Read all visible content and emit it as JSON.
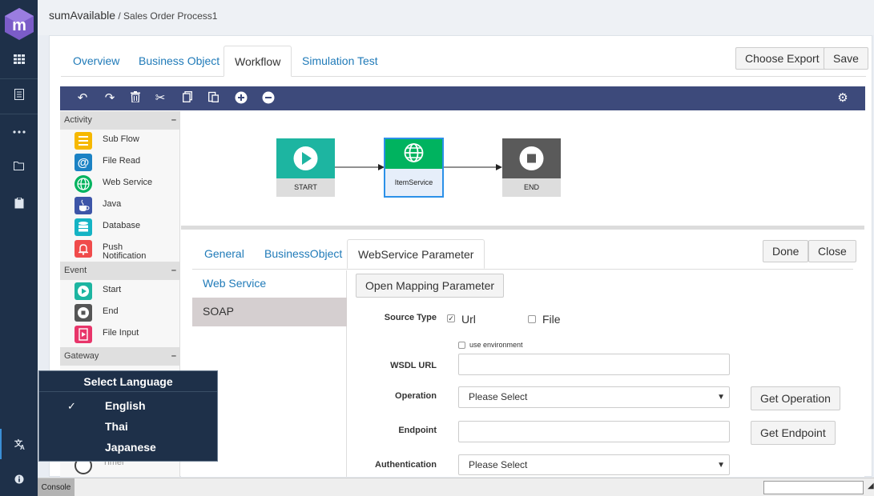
{
  "header": {
    "app_name": "sumAvailable",
    "separator": " / ",
    "process_name": "Sales Order Process1"
  },
  "rail": {
    "icons": [
      "logo-m-icon",
      "grid-icon",
      "document-icon",
      "dots-icon",
      "folder-icon",
      "clipboard-icon",
      "translate-icon",
      "info-icon"
    ]
  },
  "main_tabs": [
    {
      "label": "Overview",
      "active": false
    },
    {
      "label": "Business Object",
      "active": false
    },
    {
      "label": "Workflow",
      "active": true
    },
    {
      "label": "Simulation Test",
      "active": false
    }
  ],
  "actions": {
    "export_label": "Choose Export",
    "save_label": "Save"
  },
  "toolbar": {
    "icons": [
      "undo-icon",
      "redo-icon",
      "trash-icon",
      "scissors-icon",
      "copy-icon",
      "paste-icon",
      "zoom-in-icon",
      "zoom-out-icon",
      "settings-gear-icon"
    ]
  },
  "palette": {
    "activity": {
      "title": "Activity",
      "collapse": "–",
      "items": [
        "Sub Flow",
        "File Read",
        "Web Service",
        "Java",
        "Database",
        "Push Notification"
      ]
    },
    "event": {
      "title": "Event",
      "collapse": "–",
      "items": [
        "Start",
        "End",
        "File Input"
      ]
    },
    "gateway": {
      "title": "Gateway",
      "collapse": "–"
    },
    "partial_item": "Timer"
  },
  "diagram": {
    "nodes": [
      {
        "label": "START",
        "color": "#1db5a1"
      },
      {
        "label": "ItemService",
        "color": "#00b35f"
      },
      {
        "label": "END",
        "color": "#5a5a5a"
      }
    ]
  },
  "props": {
    "tabs": [
      {
        "label": "General",
        "active": false
      },
      {
        "label": "BusinessObject",
        "active": false
      },
      {
        "label": "WebService Parameter",
        "active": true
      }
    ],
    "done_label": "Done",
    "close_label": "Close",
    "left_nav": {
      "web_service": "Web Service",
      "soap": "SOAP"
    },
    "open_mapping_label": "Open Mapping Parameter",
    "source_type": {
      "label": "Source Type",
      "url_label": "Url",
      "url_checked": true,
      "file_label": "File",
      "file_checked": false
    },
    "use_env_label": "use environment",
    "wsdl_label": "WSDL URL",
    "wsdl_value": "",
    "operation_label": "Operation",
    "operation_value": "Please Select",
    "get_operation_label": "Get Operation",
    "endpoint_label": "Endpoint",
    "endpoint_value": "",
    "get_endpoint_label": "Get Endpoint",
    "authentication_label": "Authentication",
    "authentication_value": "Please Select"
  },
  "language_menu": {
    "title": "Select Language",
    "options": [
      "English",
      "Thai",
      "Japanese"
    ],
    "selected": "English",
    "check": "✓"
  },
  "bottom": {
    "console_label": "Console"
  }
}
